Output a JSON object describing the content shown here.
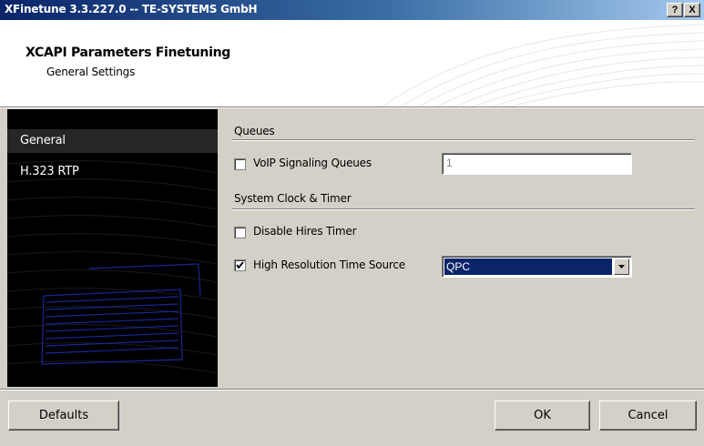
{
  "window": {
    "title": "XFinetune 3.3.227.0 -- TE-SYSTEMS GmbH",
    "help_button": "?",
    "close_button": "X"
  },
  "header": {
    "title": "XCAPI Parameters Finetuning",
    "subtitle": "General Settings"
  },
  "nav": {
    "items": [
      {
        "label": "General",
        "active": true
      },
      {
        "label": "H.323 RTP",
        "active": false
      }
    ]
  },
  "content": {
    "queues_section": "Queues",
    "voip_signaling": {
      "label": "VoIP Signaling Queues",
      "checked": false,
      "value": "1"
    },
    "clock_section": "System Clock & Timer",
    "disable_hires": {
      "label": "Disable Hires Timer",
      "checked": false
    },
    "high_res_source": {
      "label": "High Resolution Time Source",
      "checked": true,
      "selected": "QPC"
    }
  },
  "footer": {
    "defaults_label": "Defaults",
    "ok_label": "OK",
    "cancel_label": "Cancel"
  },
  "colors": {
    "title_start": "#0a246a",
    "title_end": "#a6caf0",
    "face": "#d4d0c8",
    "selection": "#0a246a"
  }
}
